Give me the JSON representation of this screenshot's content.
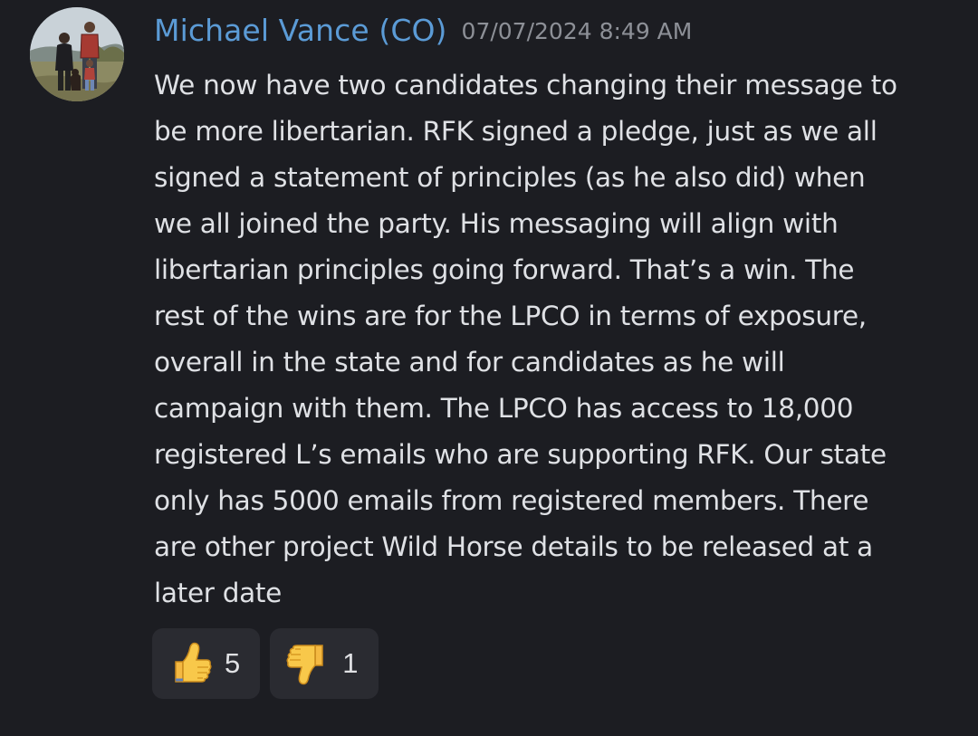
{
  "message": {
    "author": "Michael Vance (CO)",
    "timestamp": "07/07/2024 8:49 AM",
    "body": "We now have two candidates changing their message to\nbe more libertarian. RFK signed a pledge, just as we all\nsigned a statement of principles (as he also did) when\nwe all joined the party. His messaging will align with\nlibertarian principles going forward. That’s a win. The\nrest of the wins are for the LPCO in terms of exposure,\noverall in the state and for candidates as he will\ncampaign with them. The LPCO has access to 18,000\nregistered L’s emails who are supporting RFK. Our state\nonly has 5000 emails from registered members. There\nare other project Wild Horse details to be released at a\nlater date"
  },
  "reactions": [
    {
      "emoji": "thumbs-up-icon",
      "count": "5"
    },
    {
      "emoji": "thumbs-down-icon",
      "count": "1"
    }
  ],
  "colors": {
    "background": "#1c1d22",
    "author": "#5b9bd6",
    "timestamp": "#8d9097",
    "text": "#dfe1e5",
    "reaction_bg": "#2a2b31"
  }
}
